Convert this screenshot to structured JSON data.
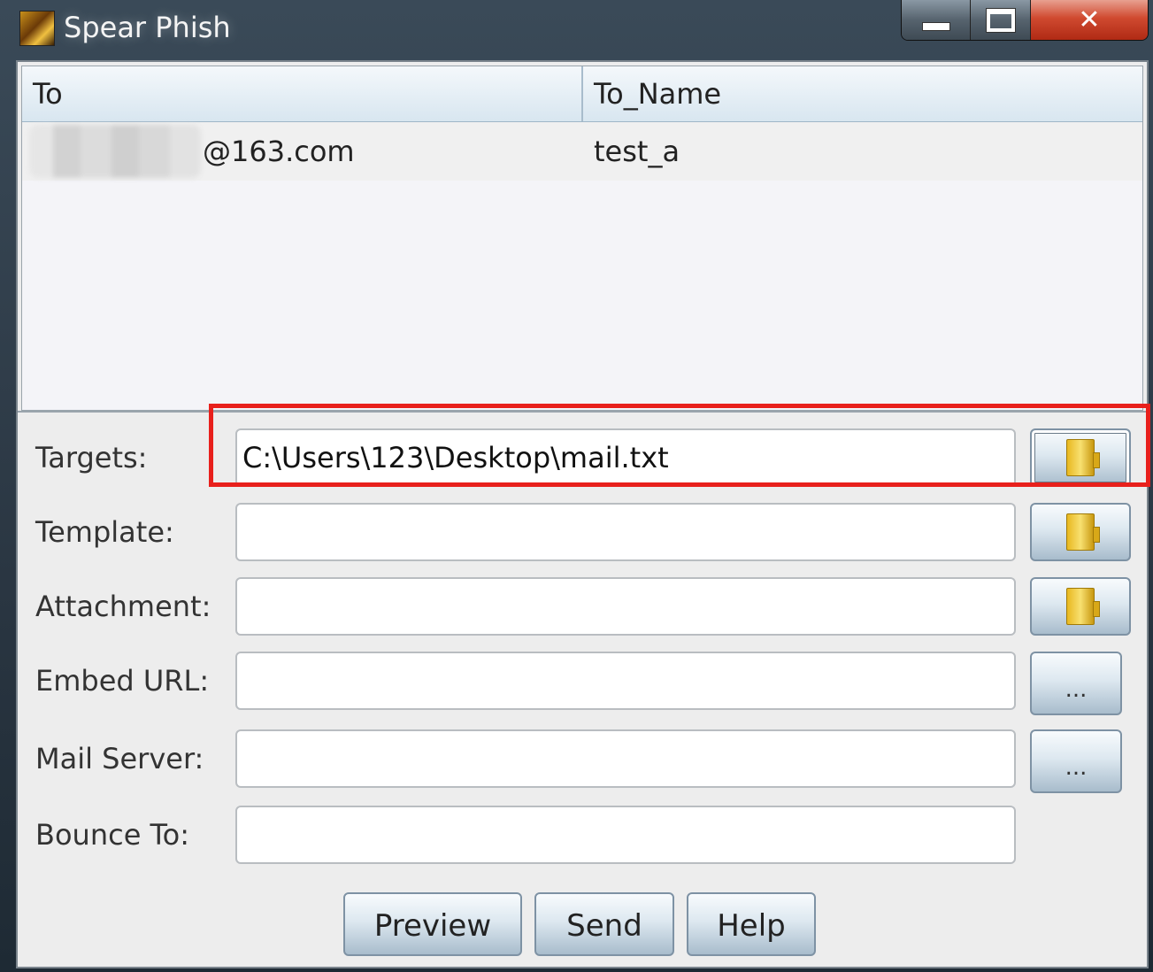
{
  "window": {
    "title": "Spear Phish",
    "controls": {
      "minimize": "",
      "maximize": "",
      "close": "✕"
    }
  },
  "table": {
    "columns": [
      "To",
      "To_Name"
    ],
    "rows": [
      {
        "to": "@163.com",
        "to_name": "test_a"
      }
    ]
  },
  "form": {
    "targets": {
      "label": "Targets:",
      "value": "C:\\Users\\123\\Desktop\\mail.txt"
    },
    "template": {
      "label": "Template:",
      "value": ""
    },
    "attachment": {
      "label": "Attachment:",
      "value": ""
    },
    "embed_url": {
      "label": "Embed URL:",
      "value": "",
      "button": "..."
    },
    "mail_server": {
      "label": "Mail Server:",
      "value": "",
      "button": "..."
    },
    "bounce_to": {
      "label": "Bounce To:",
      "value": ""
    }
  },
  "buttons": {
    "preview": "Preview",
    "send": "Send",
    "help": "Help"
  },
  "icons": {
    "app": "app-icon",
    "folder": "folder-icon"
  },
  "colors": {
    "highlight": "#e8201c",
    "close": "#d04a30"
  }
}
